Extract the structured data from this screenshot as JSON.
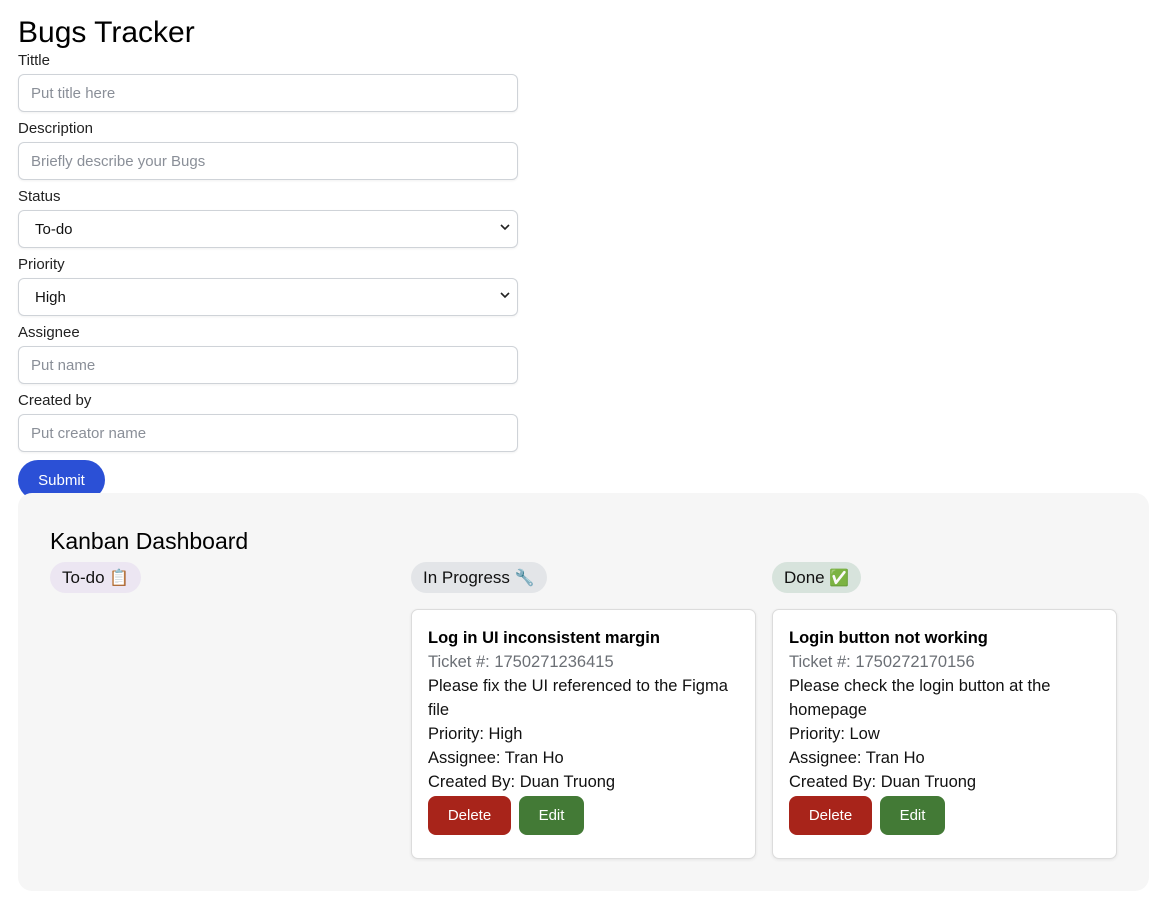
{
  "app": {
    "title": "Bugs Tracker"
  },
  "form": {
    "title_label": "Tittle",
    "title_placeholder": "Put title here",
    "description_label": "Description",
    "description_placeholder": "Briefly describe your Bugs",
    "status_label": "Status",
    "status_value": "To-do",
    "priority_label": "Priority",
    "priority_value": "High",
    "assignee_label": "Assignee",
    "assignee_placeholder": "Put name",
    "created_by_label": "Created by",
    "created_by_placeholder": "Put creator name",
    "submit_label": "Submit"
  },
  "kanban": {
    "title": "Kanban Dashboard",
    "columns": [
      {
        "label": "To-do",
        "icon": "📋"
      },
      {
        "label": "In Progress",
        "icon": "🔧"
      },
      {
        "label": "Done",
        "icon": "✅"
      }
    ],
    "cards": [
      {
        "title": "Log in UI inconsistent margin",
        "ticket": "Ticket #: 1750271236415",
        "description": "Please fix the UI referenced to the Figma file",
        "priority": "Priority: High",
        "assignee": "Assignee: Tran Ho",
        "created_by": "Created By: Duan Truong",
        "delete_label": "Delete",
        "edit_label": "Edit"
      },
      {
        "title": "Login button not working",
        "ticket": "Ticket #: 1750272170156",
        "description": "Please check the login button at the homepage",
        "priority": "Priority: Low",
        "assignee": "Assignee: Tran Ho",
        "created_by": "Created By: Duan Truong",
        "delete_label": "Delete",
        "edit_label": "Edit"
      }
    ]
  },
  "colors": {
    "submit": "#2b50d6",
    "delete": "#a8241a",
    "edit": "#437a36",
    "board_bg": "#f6f6f6"
  }
}
